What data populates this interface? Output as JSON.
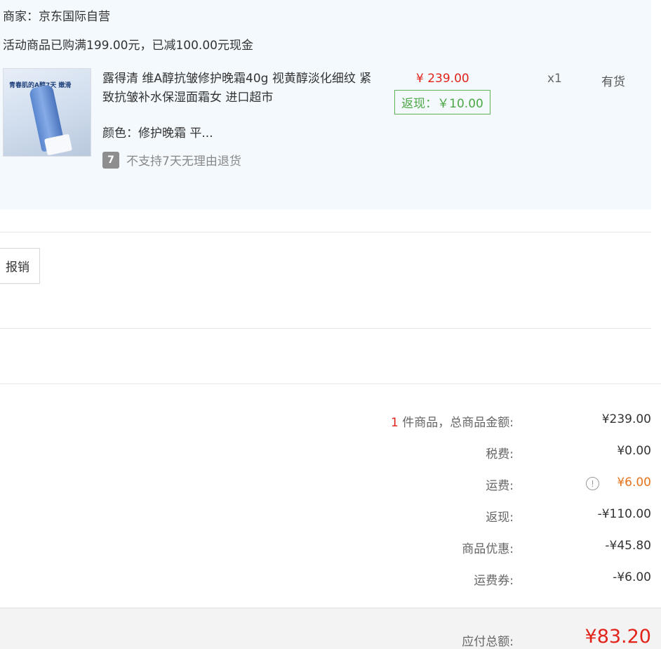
{
  "order": {
    "merchant": "商家：京东国际自营",
    "promo": "活动商品已购满199.00元，已减100.00元现金",
    "product": {
      "thumbnail_text": "青春肌的A醇7天 嫩滑",
      "title": "露得清 维A醇抗皱修护晚霜40g 视黄醇淡化细纹 紧致抗皱补水保湿面霜女 进口超市",
      "attribute": "颜色：修护晚霜 平...",
      "return_policy_icon": "7",
      "return_policy": "不支持7天无理由退货",
      "price": "¥ 239.00",
      "cashback": "返现：￥10.00",
      "quantity": "x1",
      "stock": "有货"
    }
  },
  "actions": {
    "reimburse_label": "报销"
  },
  "summary": {
    "item_count": "1",
    "items_label": " 件商品，总商品金额:",
    "items_total": "¥239.00",
    "tax_label": "税费:",
    "tax_value": "¥0.00",
    "shipping_label": "运费:",
    "shipping_info_icon": "!",
    "shipping_value": "¥6.00",
    "cashback_label": "返现:",
    "cashback_value": "-¥110.00",
    "discount_label": "商品优惠:",
    "discount_value": "-¥45.80",
    "shipping_coupon_label": "运费券:",
    "shipping_coupon_value": "-¥6.00",
    "total_label": "应付总额:",
    "total_value": "¥83.20"
  },
  "colors": {
    "price_red": "#e2231a",
    "cashback_green": "#4ca844",
    "shipping_orange": "#e5731c",
    "panel_bg": "#f3f9fd"
  }
}
